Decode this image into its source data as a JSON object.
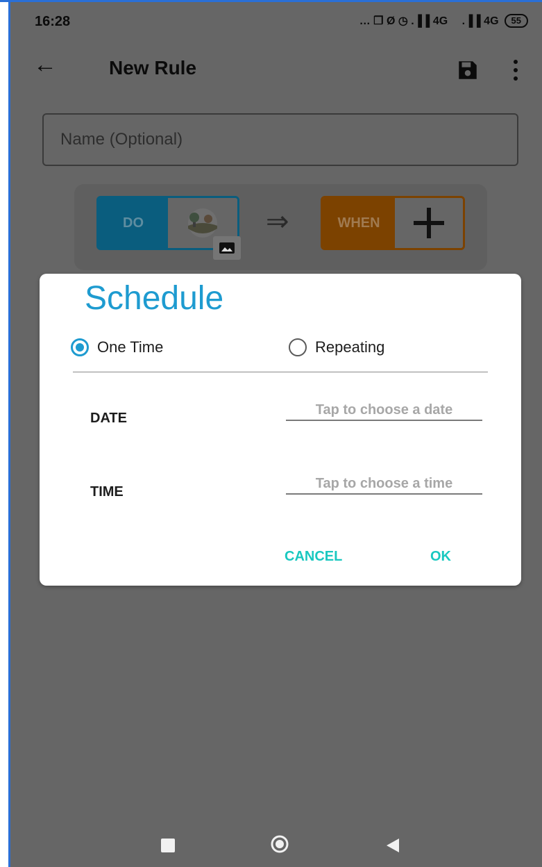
{
  "status_bar": {
    "time": "16:28",
    "indicators": "… ❐ Ø ◷ .▐▐ 4G  .▐▐ 4G",
    "battery": "55"
  },
  "app_bar": {
    "title": "New Rule",
    "icons": [
      "back-arrow-icon",
      "save-icon",
      "more-vert-icon"
    ]
  },
  "name_field": {
    "placeholder": "Name (Optional)",
    "value": ""
  },
  "rule_card": {
    "do_label": "DO",
    "when_label": "WHEN",
    "icons": [
      "landscape-image-icon",
      "image-badge-icon",
      "double-arrow-icon",
      "plus-icon"
    ]
  },
  "dialog": {
    "title": "Schedule",
    "radio_one_time": "One Time",
    "radio_repeating": "Repeating",
    "selected": "One Time",
    "date_label": "DATE",
    "date_placeholder": "Tap to choose a date",
    "time_label": "TIME",
    "time_placeholder": "Tap to choose a time",
    "cancel_label": "CANCEL",
    "ok_label": "OK"
  },
  "colors": {
    "accent_blue": "#1e9bd0",
    "button_teal": "#19c8c0",
    "do_blue": "#0a5d7e",
    "when_orange": "#7c4200",
    "scrim": "#666666"
  },
  "nav_bar": {
    "icons": [
      "recents-square-icon",
      "home-circle-icon",
      "back-triangle-icon"
    ]
  }
}
